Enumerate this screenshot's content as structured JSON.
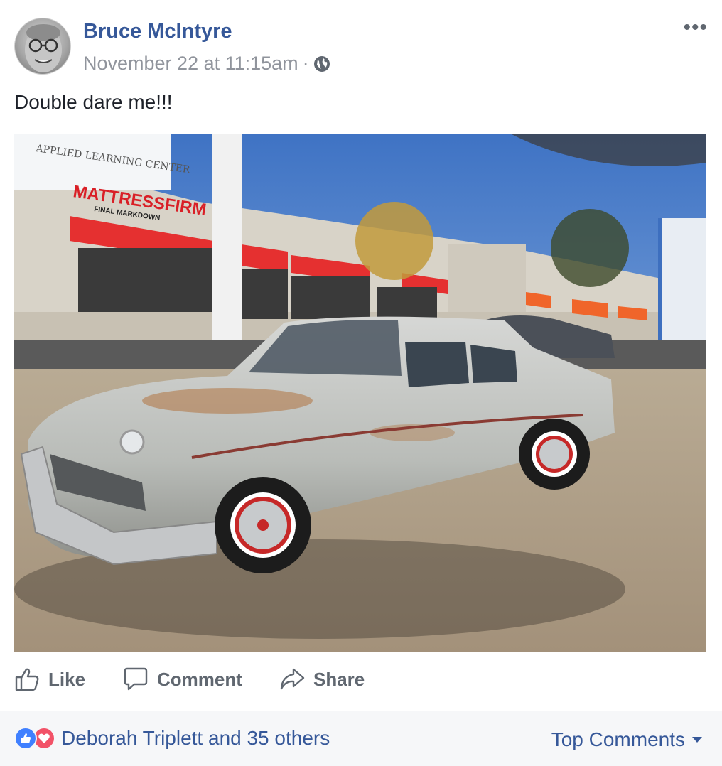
{
  "post": {
    "author": "Bruce McIntyre",
    "timestamp": "November 22 at 11:15am",
    "separator": "·",
    "audience_icon": "globe-icon",
    "more_icon": "more-options-icon",
    "more_label": "•••",
    "text": "Double dare me!!!"
  },
  "photo": {
    "subject": "photo-vintage-car",
    "sign_top": "APPLIED LEARNING CENTER",
    "sign_store": "MATTRESSFIRM",
    "sign_store_sub": "FINAL MARKDOWN"
  },
  "actions": {
    "like": "Like",
    "comment": "Comment",
    "share": "Share"
  },
  "footer": {
    "reactions_text": "Deborah Triplett and 35 others",
    "top_comments": "Top Comments",
    "reaction_icons": [
      "like-reaction-icon",
      "love-reaction-icon"
    ]
  },
  "colors": {
    "link": "#365899",
    "muted": "#90949c",
    "like_blue": "#4080ff",
    "love_red": "#f25268"
  }
}
